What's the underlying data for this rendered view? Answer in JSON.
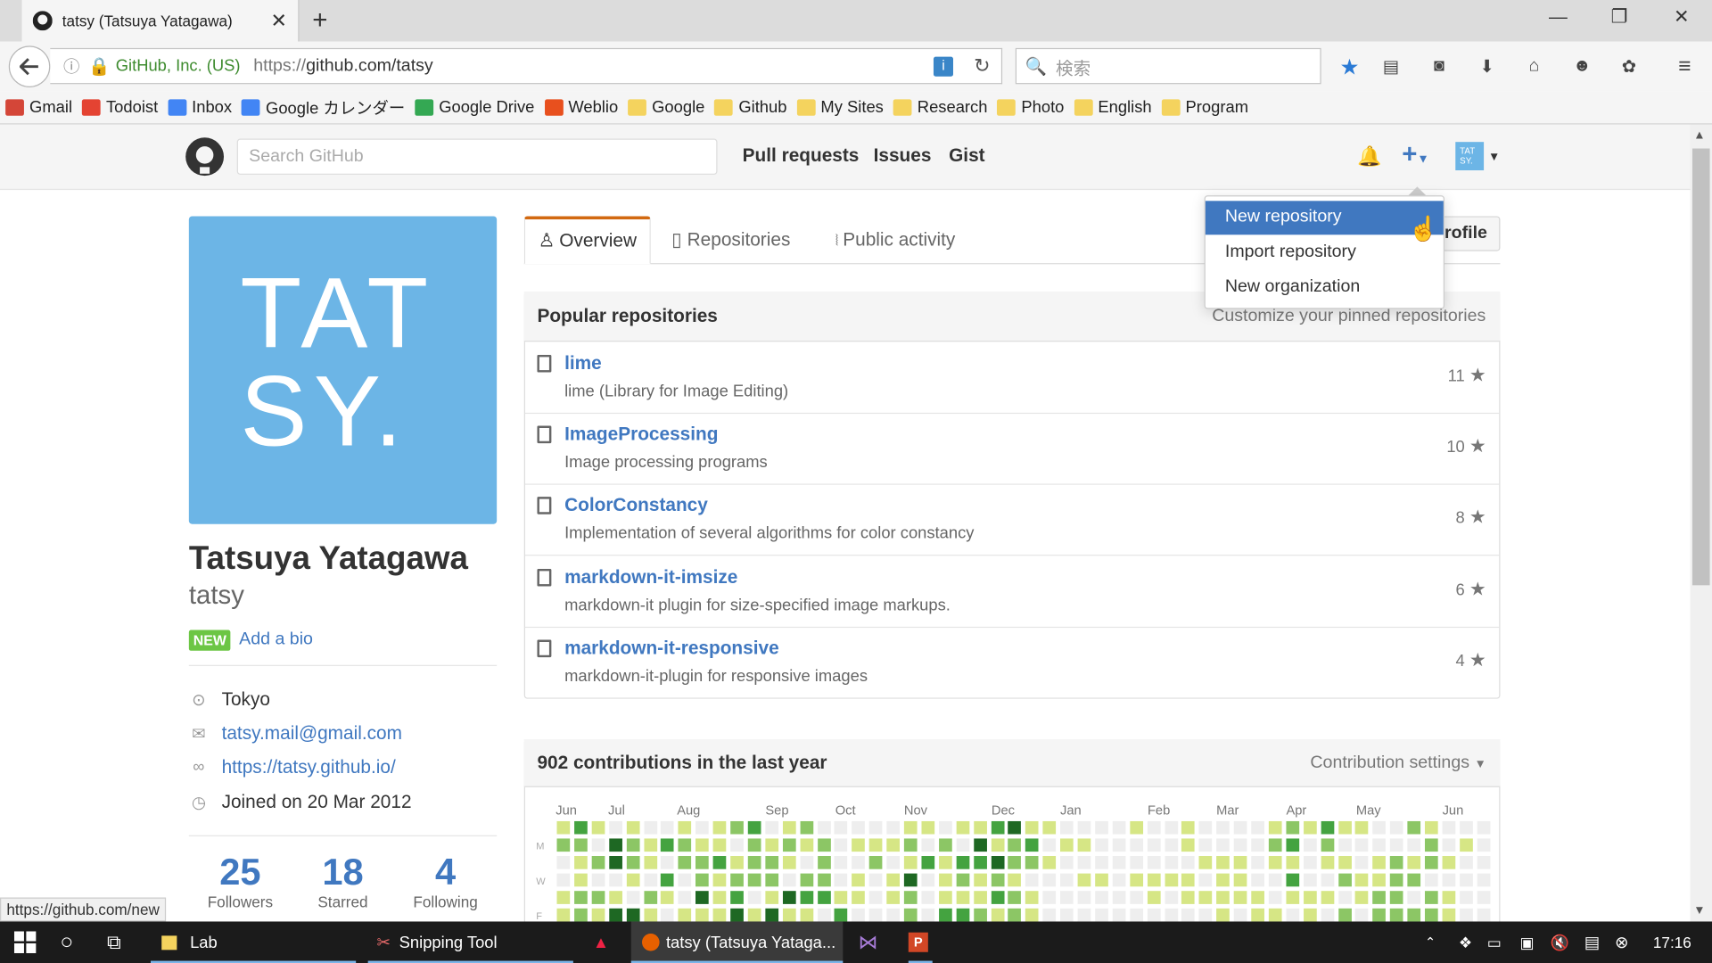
{
  "browser": {
    "tab_title": "tatsy (Tatsuya Yatagawa)",
    "identity": "GitHub, Inc. (US)",
    "url_prefix": "https://",
    "url_host": "github.com/tatsy",
    "search_placeholder": "検索",
    "status_url": "https://github.com/new"
  },
  "bookmarks": [
    {
      "label": "Gmail",
      "color": "#d44638"
    },
    {
      "label": "Todoist",
      "color": "#e44332"
    },
    {
      "label": "Inbox",
      "color": "#4285f4"
    },
    {
      "label": "Google カレンダー",
      "color": "#4285f4"
    },
    {
      "label": "Google Drive",
      "color": "#34a853"
    },
    {
      "label": "Weblio",
      "color": "#e8501e"
    },
    {
      "label": "Google",
      "color": "#f4d35e"
    },
    {
      "label": "Github",
      "color": "#f4d35e"
    },
    {
      "label": "My Sites",
      "color": "#f4d35e"
    },
    {
      "label": "Research",
      "color": "#f4d35e"
    },
    {
      "label": "Photo",
      "color": "#f4d35e"
    },
    {
      "label": "English",
      "color": "#f4d35e"
    },
    {
      "label": "Program",
      "color": "#f4d35e"
    }
  ],
  "header": {
    "search_placeholder": "Search GitHub",
    "nav": [
      "Pull requests",
      "Issues",
      "Gist"
    ],
    "avatar_text": "TAT SY."
  },
  "profile": {
    "avatar_text_line1": "TAT",
    "avatar_text_line2": "SY.",
    "full_name": "Tatsuya Yatagawa",
    "login": "tatsy",
    "new_badge": "NEW",
    "add_bio": "Add a bio",
    "location": "Tokyo",
    "email": "tatsy.mail@gmail.com",
    "website": "https://tatsy.github.io/",
    "joined": "Joined on 20 Mar 2012",
    "stats": [
      {
        "num": "25",
        "label": "Followers"
      },
      {
        "num": "18",
        "label": "Starred"
      },
      {
        "num": "4",
        "label": "Following"
      }
    ]
  },
  "tabs": {
    "overview": "Overview",
    "repositories": "Repositories",
    "activity": "Public activity",
    "edit_profile": "rofile"
  },
  "popular": {
    "title": "Popular repositories",
    "customize": "Customize your pinned repositories",
    "repos": [
      {
        "name": "lime",
        "desc": "lime (Library for Image Editing)",
        "stars": "11"
      },
      {
        "name": "ImageProcessing",
        "desc": "Image processing programs",
        "stars": "10"
      },
      {
        "name": "ColorConstancy",
        "desc": "Implementation of several algorithms for color constancy",
        "stars": "8"
      },
      {
        "name": "markdown-it-imsize",
        "desc": "markdown-it plugin for size-specified image markups.",
        "stars": "6"
      },
      {
        "name": "markdown-it-responsive",
        "desc": "markdown-it-plugin for responsive images",
        "stars": "4"
      }
    ]
  },
  "contributions": {
    "title": "902 contributions in the last year",
    "settings": "Contribution settings",
    "months": [
      "Jun",
      "Jul",
      "Aug",
      "Sep",
      "Oct",
      "Nov",
      "Dec",
      "Jan",
      "Feb",
      "Mar",
      "Apr",
      "May",
      "Jun"
    ],
    "day_labels": [
      "M",
      "W",
      "F"
    ],
    "palette": [
      "#eeeeee",
      "#d6e685",
      "#8cc665",
      "#44a340",
      "#1e6823"
    ]
  },
  "dropdown": {
    "items": [
      "New repository",
      "Import repository",
      "New organization"
    ]
  },
  "taskbar": {
    "items": [
      "Lab",
      "Snipping Tool",
      "tatsy (Tatsuya Yataga..."
    ],
    "time": "17:16"
  }
}
